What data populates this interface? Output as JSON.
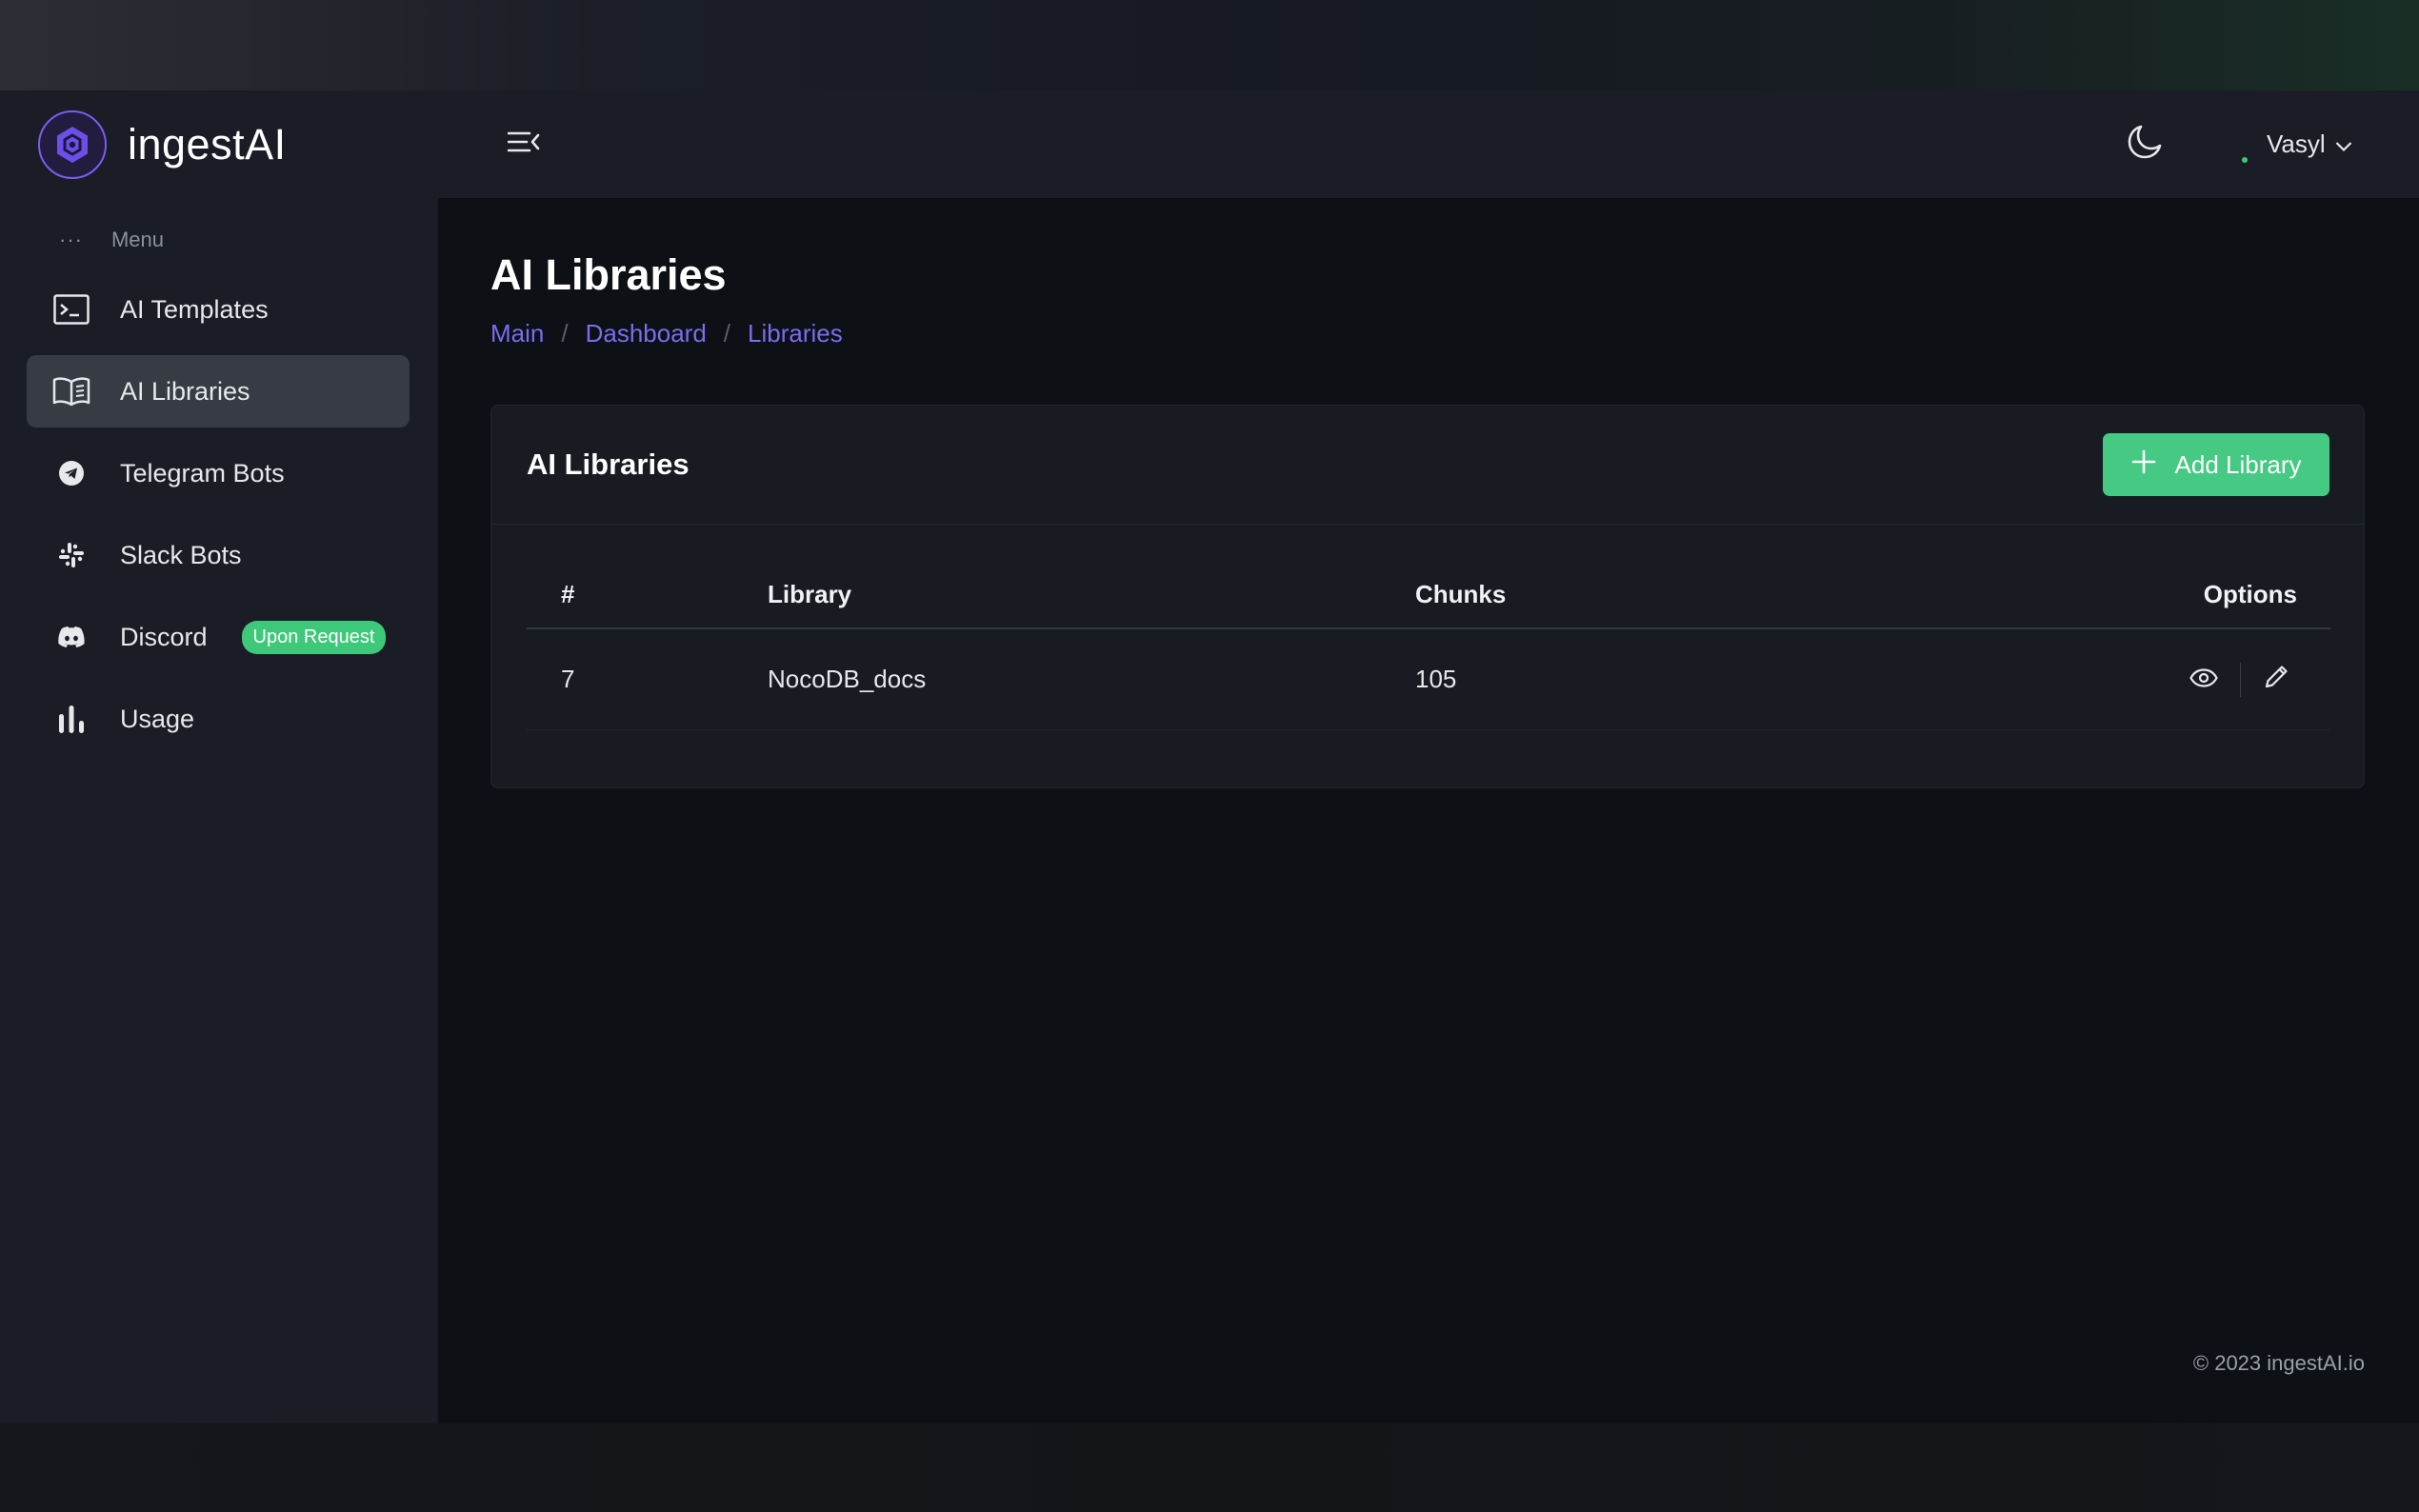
{
  "brand": {
    "name": "ingestAI"
  },
  "sidebar": {
    "menu_label": "Menu",
    "menu_dots": "···",
    "items": [
      {
        "label": "AI Templates",
        "icon": "terminal-icon",
        "active": false
      },
      {
        "label": "AI Libraries",
        "icon": "book-icon",
        "active": true
      },
      {
        "label": "Telegram Bots",
        "icon": "telegram-icon",
        "active": false
      },
      {
        "label": "Slack Bots",
        "icon": "slack-icon",
        "active": false
      },
      {
        "label": "Discord",
        "icon": "discord-icon",
        "active": false,
        "badge": "Upon Request"
      },
      {
        "label": "Usage",
        "icon": "bar-chart-icon",
        "active": false
      }
    ]
  },
  "header": {
    "user_name": "Vasyl",
    "theme_icon": "moon-icon"
  },
  "page": {
    "title": "AI Libraries",
    "breadcrumb": [
      "Main",
      "Dashboard",
      "Libraries"
    ],
    "breadcrumb_separator": "/"
  },
  "card": {
    "title": "AI Libraries",
    "add_button_label": "Add Library",
    "table": {
      "columns": [
        "#",
        "Library",
        "Chunks",
        "Options"
      ],
      "rows": [
        {
          "num": "7",
          "library": "NocoDB_docs",
          "chunks": "105"
        }
      ]
    }
  },
  "footer": {
    "text": "© 2023 ingestAI.io"
  },
  "colors": {
    "accent_purple": "#7b6cf0",
    "accent_green": "#45c983",
    "background": "#0d1014",
    "panel": "#1a1d25"
  }
}
